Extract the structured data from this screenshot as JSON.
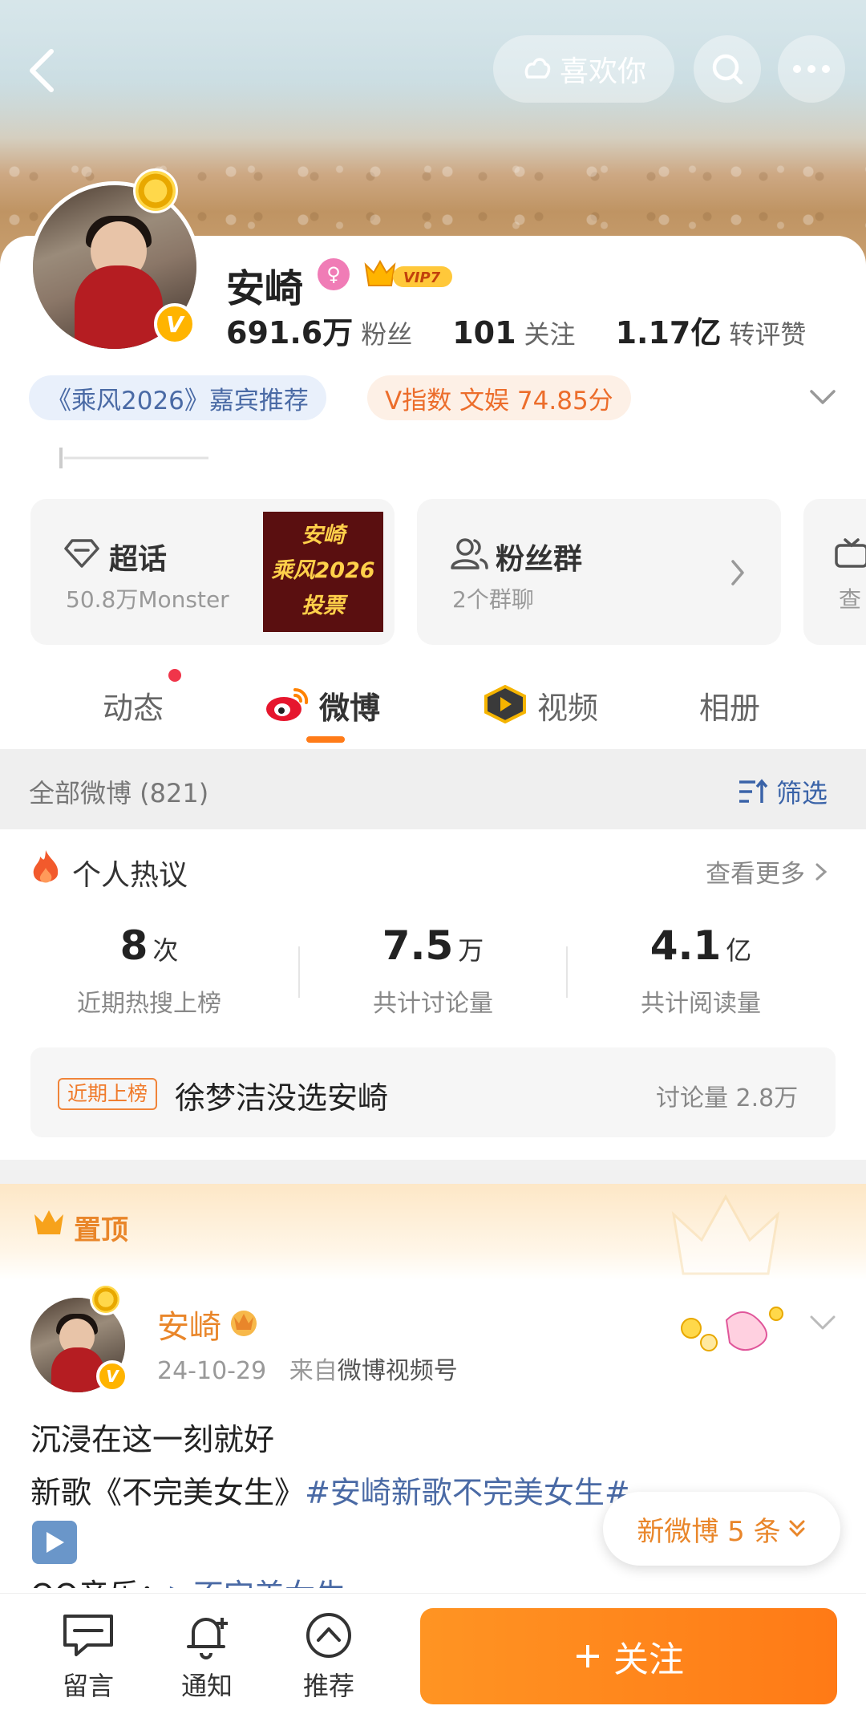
{
  "header": {
    "like_label": "喜欢你"
  },
  "profile": {
    "name": "安崎",
    "vip_label": "VIP7",
    "stats": [
      {
        "value": "691.6万",
        "label": "粉丝"
      },
      {
        "value": "101",
        "label": "关注"
      },
      {
        "value": "1.17亿",
        "label": "转评赞"
      }
    ],
    "tags": [
      {
        "text": "《乘风2026》嘉宾推荐"
      },
      {
        "text": "V指数 文娱 74.85分"
      }
    ]
  },
  "features": [
    {
      "title": "超话",
      "subtitle": "50.8万Monster",
      "promo": [
        "安崎",
        "乘风2026",
        "投票"
      ]
    },
    {
      "title": "粉丝群",
      "subtitle": "2个群聊"
    },
    {
      "subtitle": "查"
    }
  ],
  "tabs": [
    {
      "label": "动态"
    },
    {
      "label": "微博"
    },
    {
      "label": "视频"
    },
    {
      "label": "相册"
    }
  ],
  "filter": {
    "all_label": "全部微博 (821)",
    "filter_label": "筛选"
  },
  "hot": {
    "title": "个人热议",
    "more": "查看更多",
    "metrics": [
      {
        "value": "8",
        "unit": "次",
        "label": "近期热搜上榜"
      },
      {
        "value": "7.5",
        "unit": "万",
        "label": "共计讨论量"
      },
      {
        "value": "4.1",
        "unit": "亿",
        "label": "共计阅读量"
      }
    ],
    "trend": {
      "tag": "近期上榜",
      "text": "徐梦洁没选安崎",
      "count": "讨论量 2.8万"
    }
  },
  "pinned": {
    "label": "置顶"
  },
  "post": {
    "author": "安崎",
    "date": "24-10-29",
    "source_prefix": "来自",
    "source": "微博视频号",
    "line1": "沉浸在这一刻就好",
    "line2_prefix": "新歌《不完美女生》",
    "line2_tag": "#安崎新歌不完美女生#",
    "line3_prefix": "QQ音乐：",
    "line3_link": "▷不完美女生"
  },
  "new_posts": {
    "label": "新微博 5 条"
  },
  "bottom": {
    "items": [
      {
        "label": "留言"
      },
      {
        "label": "通知"
      },
      {
        "label": "推荐"
      }
    ],
    "follow": "关注"
  },
  "colors": {
    "accent": "#ff7b18",
    "link": "#4a6aa5",
    "pinned": "#e9862a"
  }
}
